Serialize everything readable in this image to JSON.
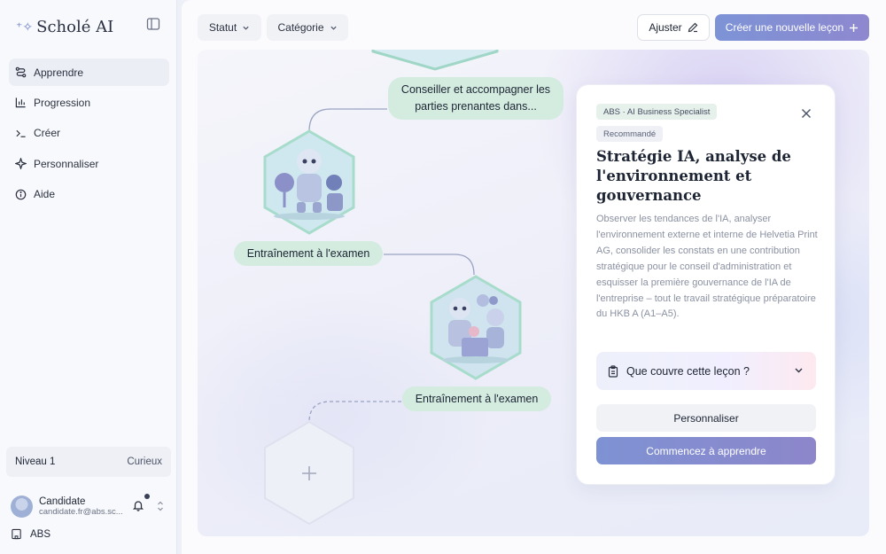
{
  "sidebar": {
    "brand": "Scholé AI",
    "nav": [
      {
        "label": "Apprendre",
        "icon": "route-icon",
        "active": true
      },
      {
        "label": "Progression",
        "icon": "bar-chart-icon",
        "active": false
      },
      {
        "label": "Créer",
        "icon": "terminal-icon",
        "active": false
      },
      {
        "label": "Personnaliser",
        "icon": "sparkle-icon",
        "active": false
      },
      {
        "label": "Aide",
        "icon": "info-icon",
        "active": false
      }
    ],
    "level": {
      "label": "Niveau 1",
      "tier": "Curieux"
    },
    "user": {
      "name": "Candidate",
      "email": "candidate.fr@abs.sc..."
    },
    "org": "ABS"
  },
  "toolbar": {
    "status_label": "Statut",
    "category_label": "Catégorie",
    "adjust_label": "Ajuster",
    "create_label": "Créer une nouvelle leçon"
  },
  "path": {
    "node1_label": "Conseiller et accompagner les parties prenantes dans...",
    "node2_label": "Entraînement à l'examen",
    "node3_label": "Entraînement à l'examen",
    "add_icon": "plus-icon"
  },
  "card": {
    "tag": "ABS · AI Business Specialist",
    "badge": "Recommandé",
    "title": "Stratégie IA, analyse de l'environnement et gouvernance",
    "description": "Observer les tendances de l'IA, analyser l'environnement externe et interne de Helvetia Print AG, consolider les constats en une contribution stratégique pour le conseil d'administration et esquisser la première gouvernance de l'IA de l'entreprise – tout le travail stratégique préparatoire du HKB A (A1–A5).",
    "accordion_label": "Que couvre cette leçon ?",
    "personalize_label": "Personnaliser",
    "start_label": "Commencez à apprendre"
  },
  "colors": {
    "accent": "#7e92d3",
    "pill_bg": "#d3ecdf",
    "hex_border": "#9fd6c5"
  }
}
